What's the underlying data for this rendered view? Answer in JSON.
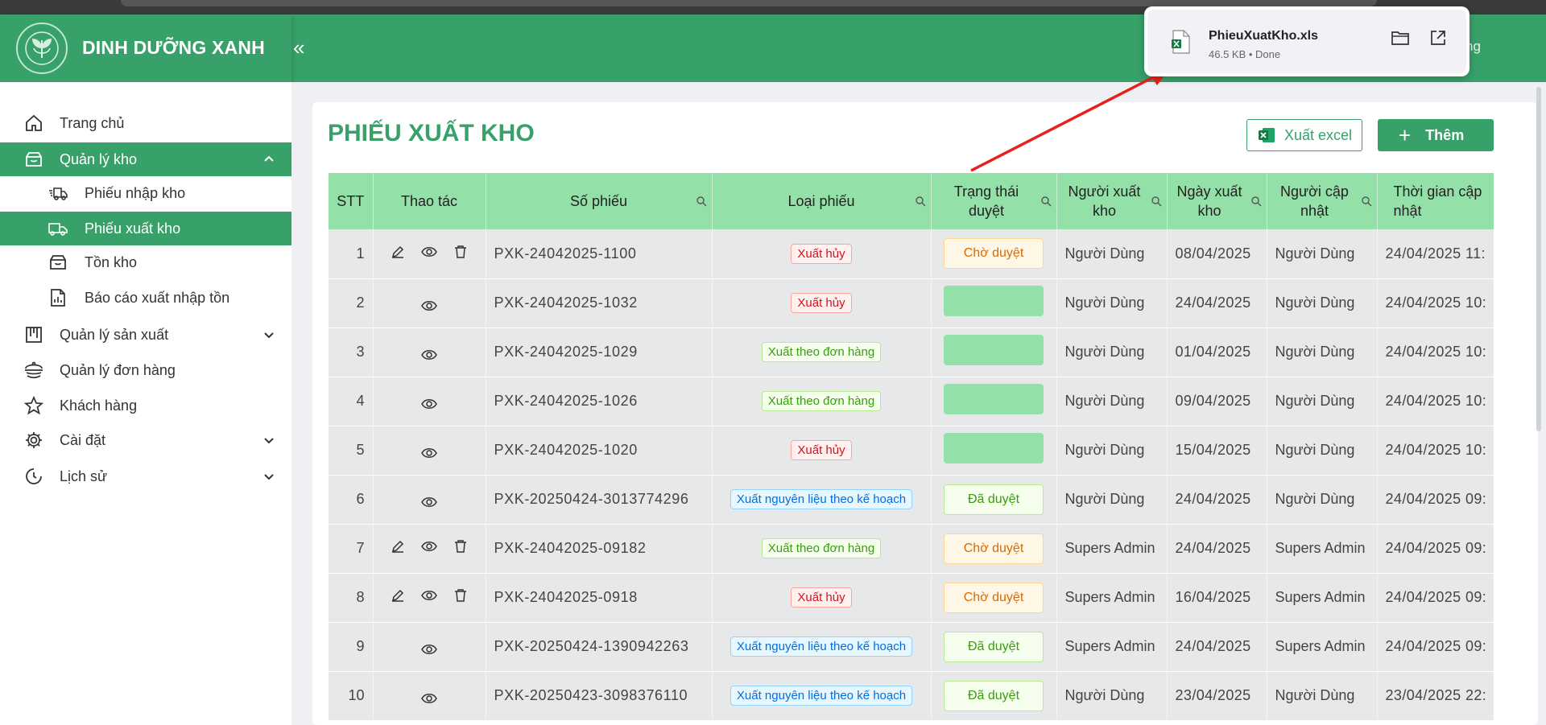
{
  "app": {
    "brand": "DINH DƯỠNG XANH",
    "user_partial": "ng",
    "accent": "#38a169"
  },
  "sidebar": {
    "items": [
      {
        "label": "Trang chủ",
        "icon": "home-icon"
      },
      {
        "label": "Quản lý kho",
        "icon": "warehouse-icon",
        "expanded": true
      },
      {
        "label": "Phiếu nhập kho",
        "icon": "truck-in-icon"
      },
      {
        "label": "Phiếu xuất kho",
        "icon": "truck-out-icon",
        "active": true
      },
      {
        "label": "Tồn kho",
        "icon": "inventory-icon"
      },
      {
        "label": "Báo cáo xuất nhập tồn",
        "icon": "report-icon"
      },
      {
        "label": "Quản lý sản xuất",
        "icon": "production-icon"
      },
      {
        "label": "Quản lý đơn hàng",
        "icon": "orders-icon"
      },
      {
        "label": "Khách hàng",
        "icon": "star-icon"
      },
      {
        "label": "Cài đặt",
        "icon": "gear-icon"
      },
      {
        "label": "Lịch sử",
        "icon": "history-icon"
      }
    ]
  },
  "page": {
    "title": "PHIẾU XUẤT KHO",
    "export_label": "Xuất excel",
    "add_label": "Thêm"
  },
  "table": {
    "columns": [
      "STT",
      "Thao tác",
      "Số phiếu",
      "Loại phiếu",
      "Trạng thái duyệt",
      "Người xuất kho",
      "Ngày xuất kho",
      "Người cập nhật",
      "Thời gian cập nhật"
    ],
    "rows": [
      {
        "stt": "1",
        "edit": true,
        "delete": true,
        "code": "PXK-24042025-1100",
        "type": "Xuất hủy",
        "type_color": "red",
        "status": "Chờ duyệt",
        "status_kind": "wait",
        "exporter": "Người Dùng",
        "date": "08/04/2025",
        "updater": "Người Dùng",
        "updated": "24/04/2025 11:"
      },
      {
        "stt": "2",
        "edit": false,
        "delete": false,
        "code": "PXK-24042025-1032",
        "type": "Xuất hủy",
        "type_color": "red",
        "status": "",
        "status_kind": "blank",
        "exporter": "Người Dùng",
        "date": "24/04/2025",
        "updater": "Người Dùng",
        "updated": "24/04/2025 10:"
      },
      {
        "stt": "3",
        "edit": false,
        "delete": false,
        "code": "PXK-24042025-1029",
        "type": "Xuất theo đơn hàng",
        "type_color": "green",
        "status": "",
        "status_kind": "blank",
        "exporter": "Người Dùng",
        "date": "01/04/2025",
        "updater": "Người Dùng",
        "updated": "24/04/2025 10:"
      },
      {
        "stt": "4",
        "edit": false,
        "delete": false,
        "code": "PXK-24042025-1026",
        "type": "Xuất theo đơn hàng",
        "type_color": "green",
        "status": "",
        "status_kind": "blank",
        "exporter": "Người Dùng",
        "date": "09/04/2025",
        "updater": "Người Dùng",
        "updated": "24/04/2025 10:"
      },
      {
        "stt": "5",
        "edit": false,
        "delete": false,
        "code": "PXK-24042025-1020",
        "type": "Xuất hủy",
        "type_color": "red",
        "status": "",
        "status_kind": "blank",
        "exporter": "Người Dùng",
        "date": "15/04/2025",
        "updater": "Người Dùng",
        "updated": "24/04/2025 10:"
      },
      {
        "stt": "6",
        "edit": false,
        "delete": false,
        "code": "PXK-20250424-3013774296",
        "type": "Xuất nguyên liệu theo kế hoạch",
        "type_color": "blue",
        "status": "Đã duyệt",
        "status_kind": "ok",
        "exporter": "Người Dùng",
        "date": "24/04/2025",
        "updater": "Người Dùng",
        "updated": "24/04/2025 09:"
      },
      {
        "stt": "7",
        "edit": true,
        "delete": true,
        "code": "PXK-24042025-09182",
        "type": "Xuất theo đơn hàng",
        "type_color": "green",
        "status": "Chờ duyệt",
        "status_kind": "wait",
        "exporter": "Supers Admin",
        "date": "24/04/2025",
        "updater": "Supers Admin",
        "updated": "24/04/2025 09:"
      },
      {
        "stt": "8",
        "edit": true,
        "delete": true,
        "code": "PXK-24042025-0918",
        "type": "Xuất hủy",
        "type_color": "red",
        "status": "Chờ duyệt",
        "status_kind": "wait",
        "exporter": "Supers Admin",
        "date": "16/04/2025",
        "updater": "Supers Admin",
        "updated": "24/04/2025 09:"
      },
      {
        "stt": "9",
        "edit": false,
        "delete": false,
        "code": "PXK-20250424-1390942263",
        "type": "Xuất nguyên liệu theo kế hoạch",
        "type_color": "blue",
        "status": "Đã duyệt",
        "status_kind": "ok",
        "exporter": "Supers Admin",
        "date": "24/04/2025",
        "updater": "Supers Admin",
        "updated": "24/04/2025 09:"
      },
      {
        "stt": "10",
        "edit": false,
        "delete": false,
        "code": "PXK-20250423-3098376110",
        "type": "Xuất nguyên liệu theo kế hoạch",
        "type_color": "blue",
        "status": "Đã duyệt",
        "status_kind": "ok",
        "exporter": "Người Dùng",
        "date": "23/04/2025",
        "updater": "Người Dùng",
        "updated": "23/04/2025 22:"
      }
    ]
  },
  "download": {
    "filename": "PhieuXuatKho.xls",
    "meta": "46.5 KB • Done"
  }
}
